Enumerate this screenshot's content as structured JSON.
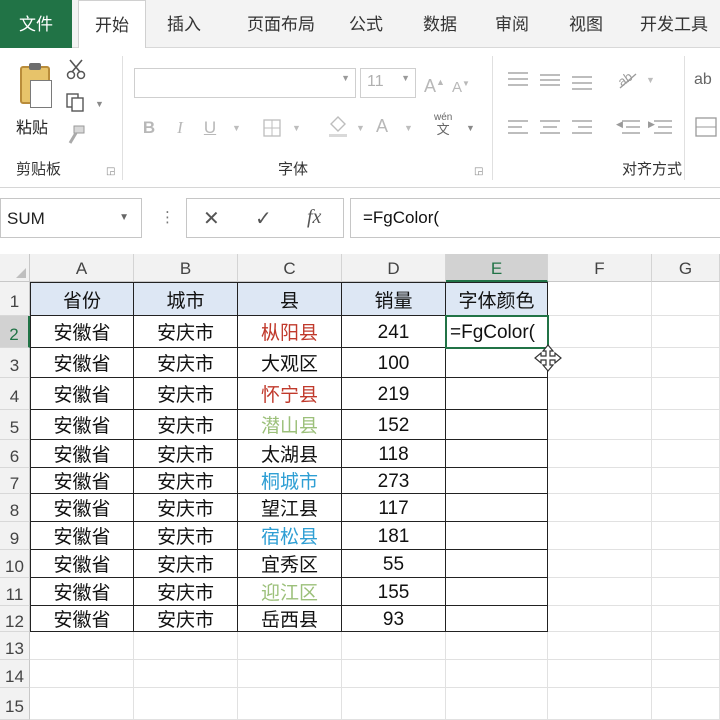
{
  "tabs": {
    "file": "文件",
    "home": "开始",
    "insert": "插入",
    "page_layout": "页面布局",
    "formulas": "公式",
    "data": "数据",
    "review": "审阅",
    "view": "视图",
    "developer": "开发工具"
  },
  "ribbon": {
    "clipboard": {
      "paste_label": "粘贴",
      "group_label": "剪贴板"
    },
    "font": {
      "font_name": "",
      "font_size": "11",
      "group_label": "字体",
      "bold": "B",
      "italic": "I",
      "underline": "U",
      "wen": "wén\n文"
    },
    "alignment": {
      "group_label": "对齐方式"
    },
    "extra_label": "ab"
  },
  "formula_bar": {
    "name_box": "SUM",
    "formula": "=FgColor(",
    "cancel_icon": "close-icon",
    "enter_icon": "check-icon",
    "fx_label": "fx"
  },
  "sheet": {
    "columns": [
      "A",
      "B",
      "C",
      "D",
      "E",
      "F",
      "G"
    ],
    "selected_column": "E",
    "selected_row": "2",
    "row_numbers": [
      "1",
      "2",
      "3",
      "4",
      "5",
      "6",
      "7",
      "8",
      "9",
      "10",
      "11",
      "12",
      "13",
      "14",
      "15"
    ],
    "header": [
      "省份",
      "城市",
      "县",
      "销量",
      "字体颜色"
    ],
    "rows": [
      {
        "province": "安徽省",
        "city": "安庆市",
        "county": "枞阳县",
        "sales": "241",
        "county_color": "#c0392b"
      },
      {
        "province": "安徽省",
        "city": "安庆市",
        "county": "大观区",
        "sales": "100",
        "county_color": "#111111"
      },
      {
        "province": "安徽省",
        "city": "安庆市",
        "county": "怀宁县",
        "sales": "219",
        "county_color": "#c0392b"
      },
      {
        "province": "安徽省",
        "city": "安庆市",
        "county": "潜山县",
        "sales": "152",
        "county_color": "#9cc07a"
      },
      {
        "province": "安徽省",
        "city": "安庆市",
        "county": "太湖县",
        "sales": "118",
        "county_color": "#111111"
      },
      {
        "province": "安徽省",
        "city": "安庆市",
        "county": "桐城市",
        "sales": "273",
        "county_color": "#2f9fd4"
      },
      {
        "province": "安徽省",
        "city": "安庆市",
        "county": "望江县",
        "sales": "117",
        "county_color": "#111111"
      },
      {
        "province": "安徽省",
        "city": "安庆市",
        "county": "宿松县",
        "sales": "181",
        "county_color": "#2f9fd4"
      },
      {
        "province": "安徽省",
        "city": "安庆市",
        "county": "宜秀区",
        "sales": "55",
        "county_color": "#111111"
      },
      {
        "province": "安徽省",
        "city": "安庆市",
        "county": "迎江区",
        "sales": "155",
        "county_color": "#9cc07a"
      },
      {
        "province": "安徽省",
        "city": "安庆市",
        "county": "岳西县",
        "sales": "93",
        "county_color": "#111111"
      }
    ],
    "active_cell_text": "=FgColor(",
    "header_fill": "#dde7f4",
    "accent": "#217346"
  }
}
